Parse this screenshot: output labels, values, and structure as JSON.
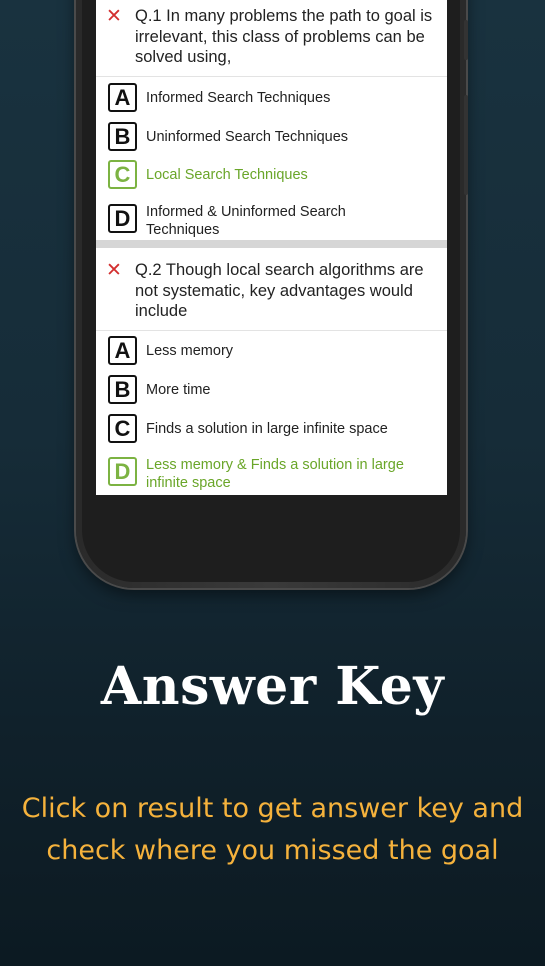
{
  "questions": [
    {
      "number_text": "Q.1 In many problems the path to goal is irrelevant, this class of problems can be solved using,",
      "status_icon": "cross-icon",
      "options": [
        {
          "letter": "A",
          "text": "Informed Search Techniques",
          "correct": false
        },
        {
          "letter": "B",
          "text": "Uninformed Search Techniques",
          "correct": false
        },
        {
          "letter": "C",
          "text": "Local Search Techniques",
          "correct": true
        },
        {
          "letter": "D",
          "text": "Informed & Uninformed Search Techniques",
          "correct": false
        }
      ]
    },
    {
      "number_text": "Q.2 Though local search algorithms are not systematic, key advantages would include",
      "status_icon": "cross-icon",
      "options": [
        {
          "letter": "A",
          "text": "Less memory",
          "correct": false
        },
        {
          "letter": "B",
          "text": "More time",
          "correct": false
        },
        {
          "letter": "C",
          "text": "Finds a solution in large infinite space",
          "correct": false
        },
        {
          "letter": "D",
          "text": "Less memory & Finds a solution in large infinite space",
          "correct": true
        }
      ]
    }
  ],
  "promo": {
    "heading": "Answer Key",
    "subtitle": "Click on result to get answer key and check where you missed the goal"
  },
  "colors": {
    "correct": "#7cb342",
    "wrong_mark": "#d32f2f",
    "subtitle": "#f5b23c",
    "background": "#162c38"
  }
}
